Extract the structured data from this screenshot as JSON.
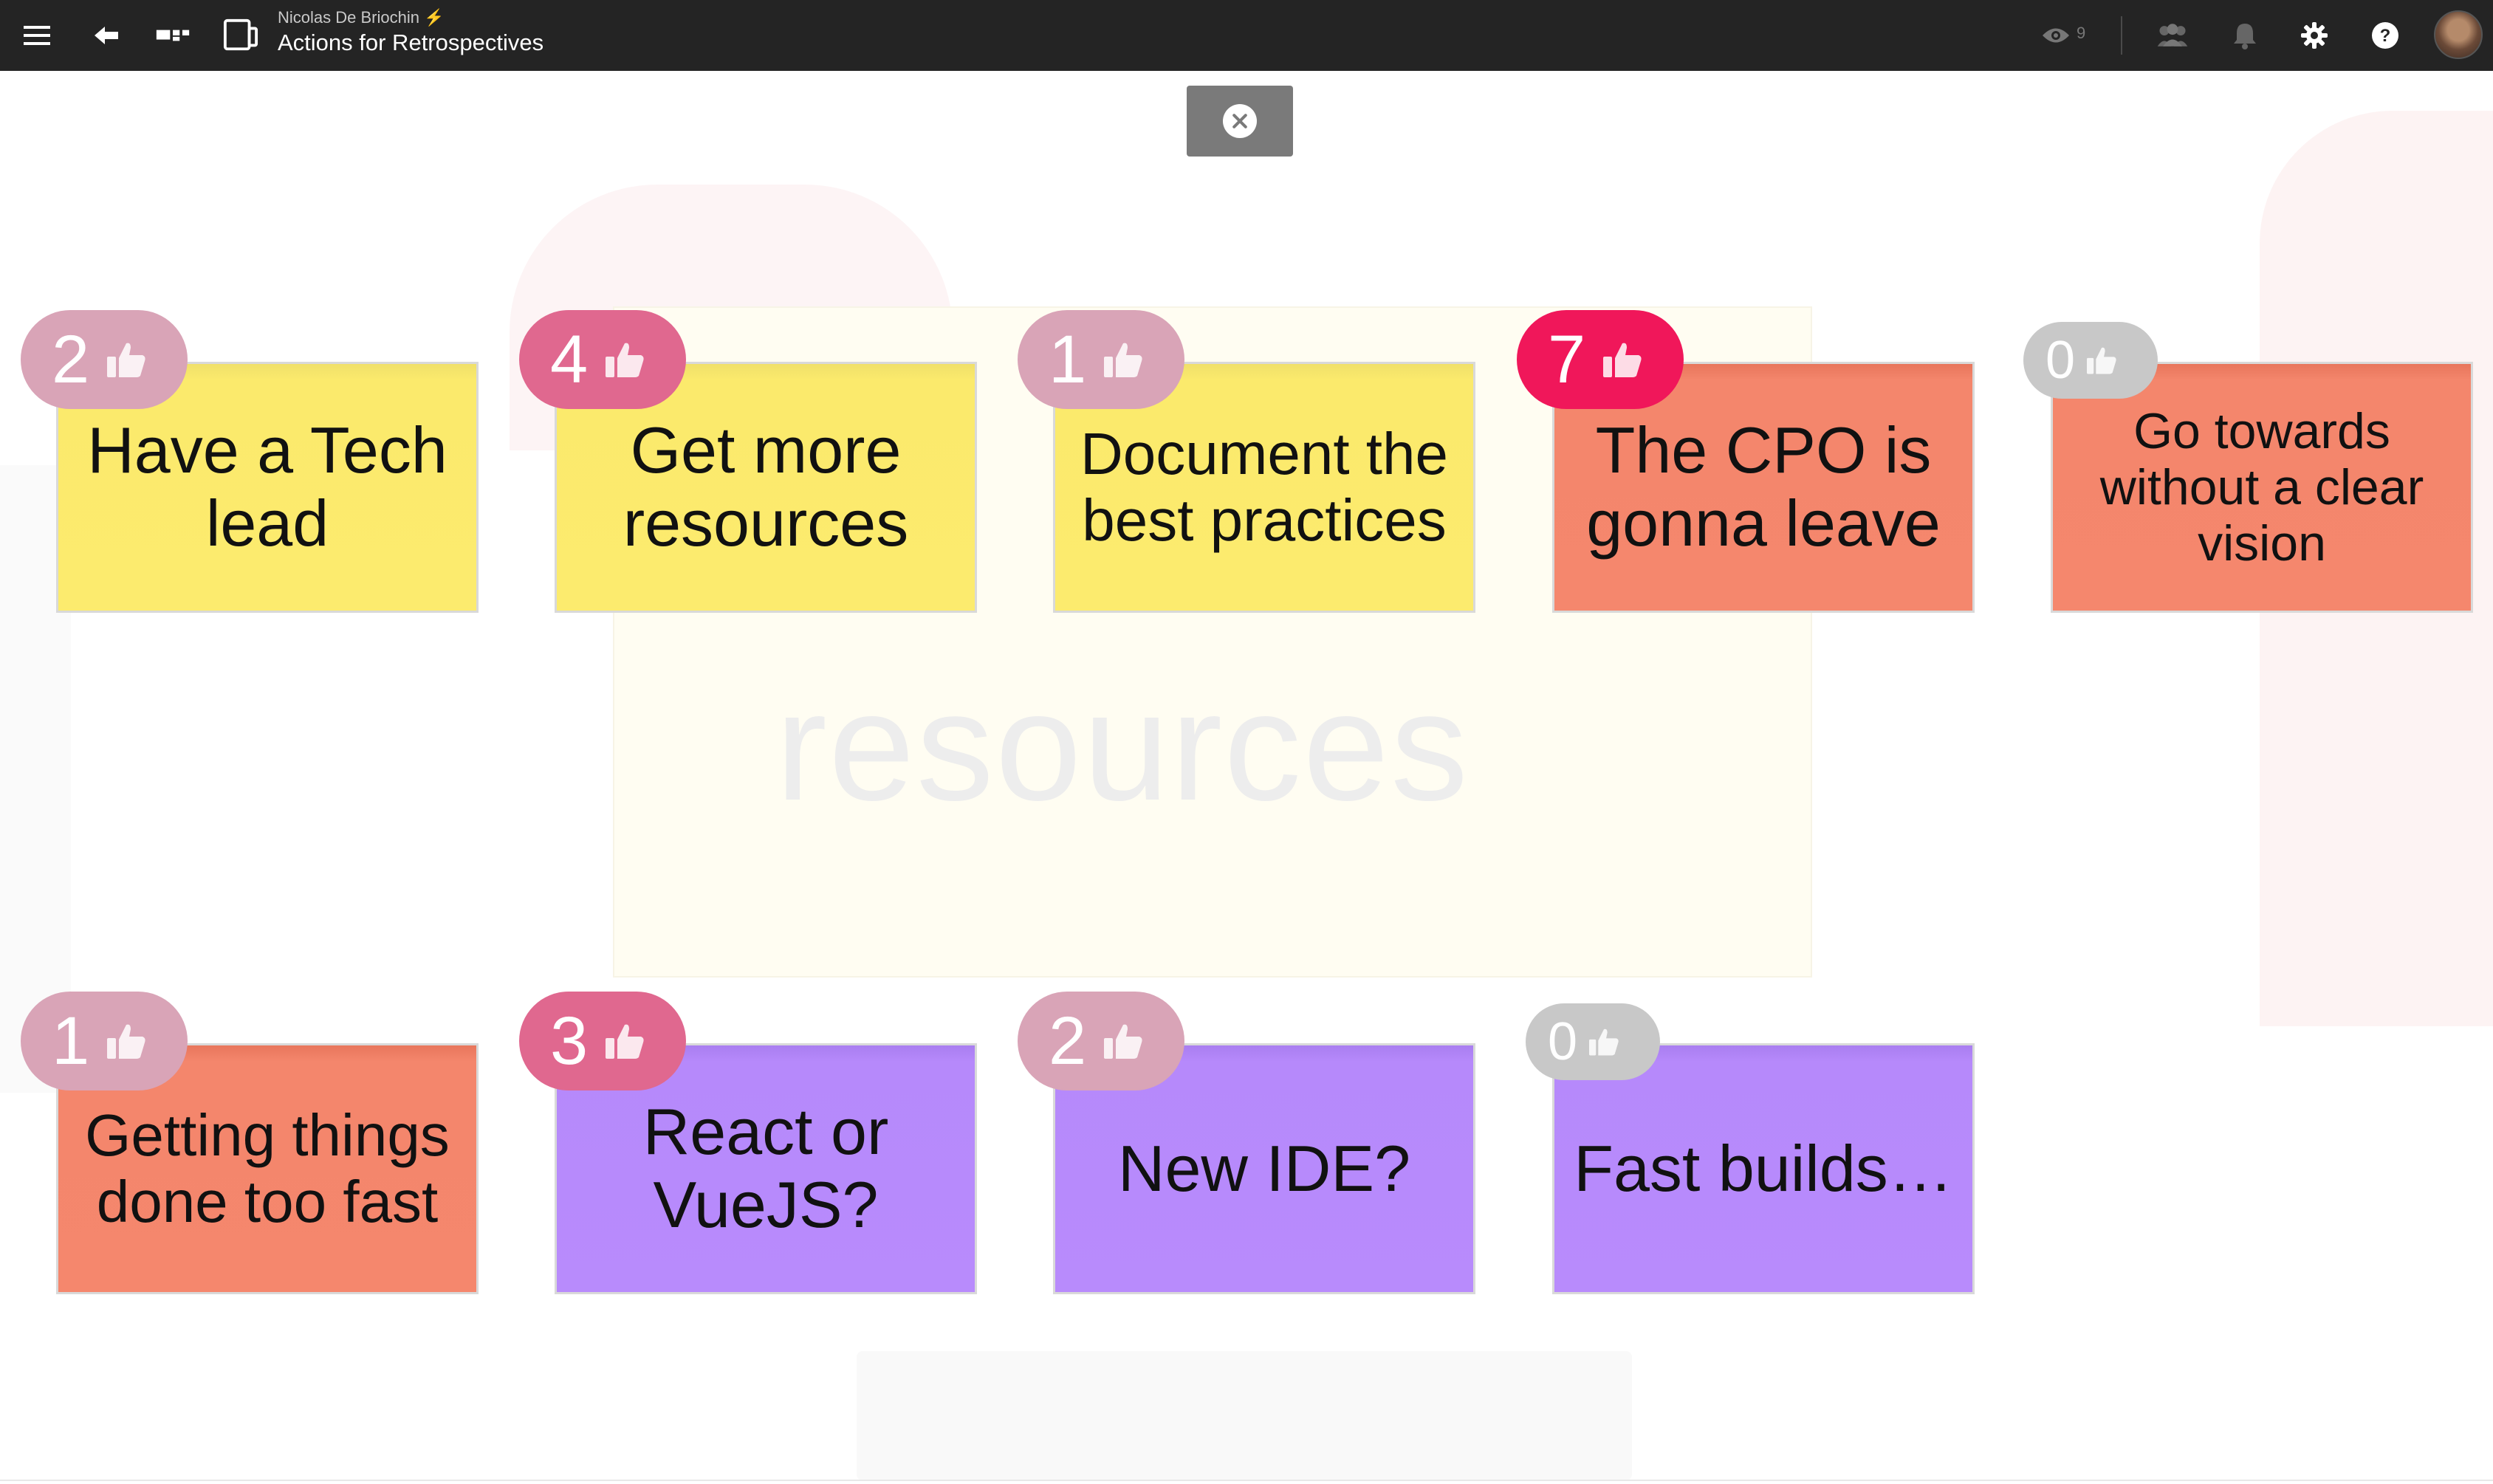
{
  "header": {
    "owner": "Nicolas De Briochin",
    "title": "Actions for Retrospectives",
    "viewer_count": "9"
  },
  "ghost": {
    "word": "resources"
  },
  "stickies": [
    {
      "text": "Have a Tech lead",
      "votes": "2",
      "color": "#fceb6e"
    },
    {
      "text": "Get more resources",
      "votes": "4",
      "color": "#fceb6e"
    },
    {
      "text": "Document the best practices",
      "votes": "1",
      "color": "#fceb6e"
    },
    {
      "text": "The CPO is gonna leave",
      "votes": "7",
      "color": "#f5876d"
    },
    {
      "text": "Go towards without a clear vision",
      "votes": "0",
      "color": "#f5876d"
    },
    {
      "text": "Getting things done too fast",
      "votes": "1",
      "color": "#f5876d"
    },
    {
      "text": "React or VueJS?",
      "votes": "3",
      "color": "#b88bfc"
    },
    {
      "text": "New IDE?",
      "votes": "2",
      "color": "#b88bfc"
    },
    {
      "text": "Fast builds…",
      "votes": "0",
      "color": "#b88bfc"
    }
  ],
  "colors": {
    "topbar": "#242424",
    "vote_low": "#d9a4b7",
    "vote_mid": "#e0688f",
    "vote_high": "#f0175a",
    "vote_zero": "#c8c8c8"
  }
}
